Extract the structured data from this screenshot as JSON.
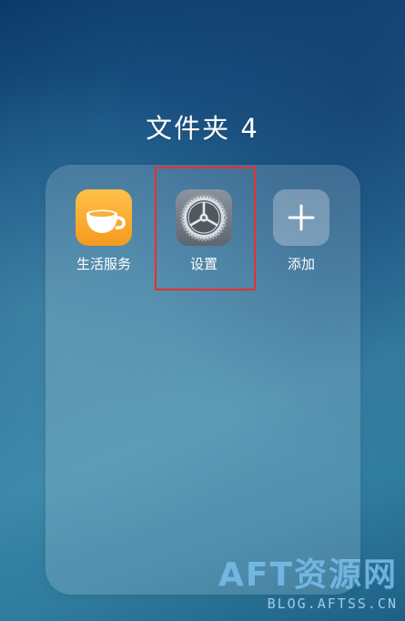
{
  "folder": {
    "title": "文件夹 4"
  },
  "apps": [
    {
      "label": "生活服务",
      "icon": "coffee-cup-icon"
    },
    {
      "label": "设置",
      "icon": "gear-icon"
    },
    {
      "label": "添加",
      "icon": "plus-icon"
    }
  ],
  "highlight": {
    "target": "设置",
    "color": "#e8302e"
  },
  "watermark": {
    "main": "AFT资源网",
    "sub": "BLOG.AFTSS.CN"
  },
  "colors": {
    "life_icon": "#f49a1e",
    "settings_icon": "#6b747e",
    "accent_red": "#e8302e"
  }
}
